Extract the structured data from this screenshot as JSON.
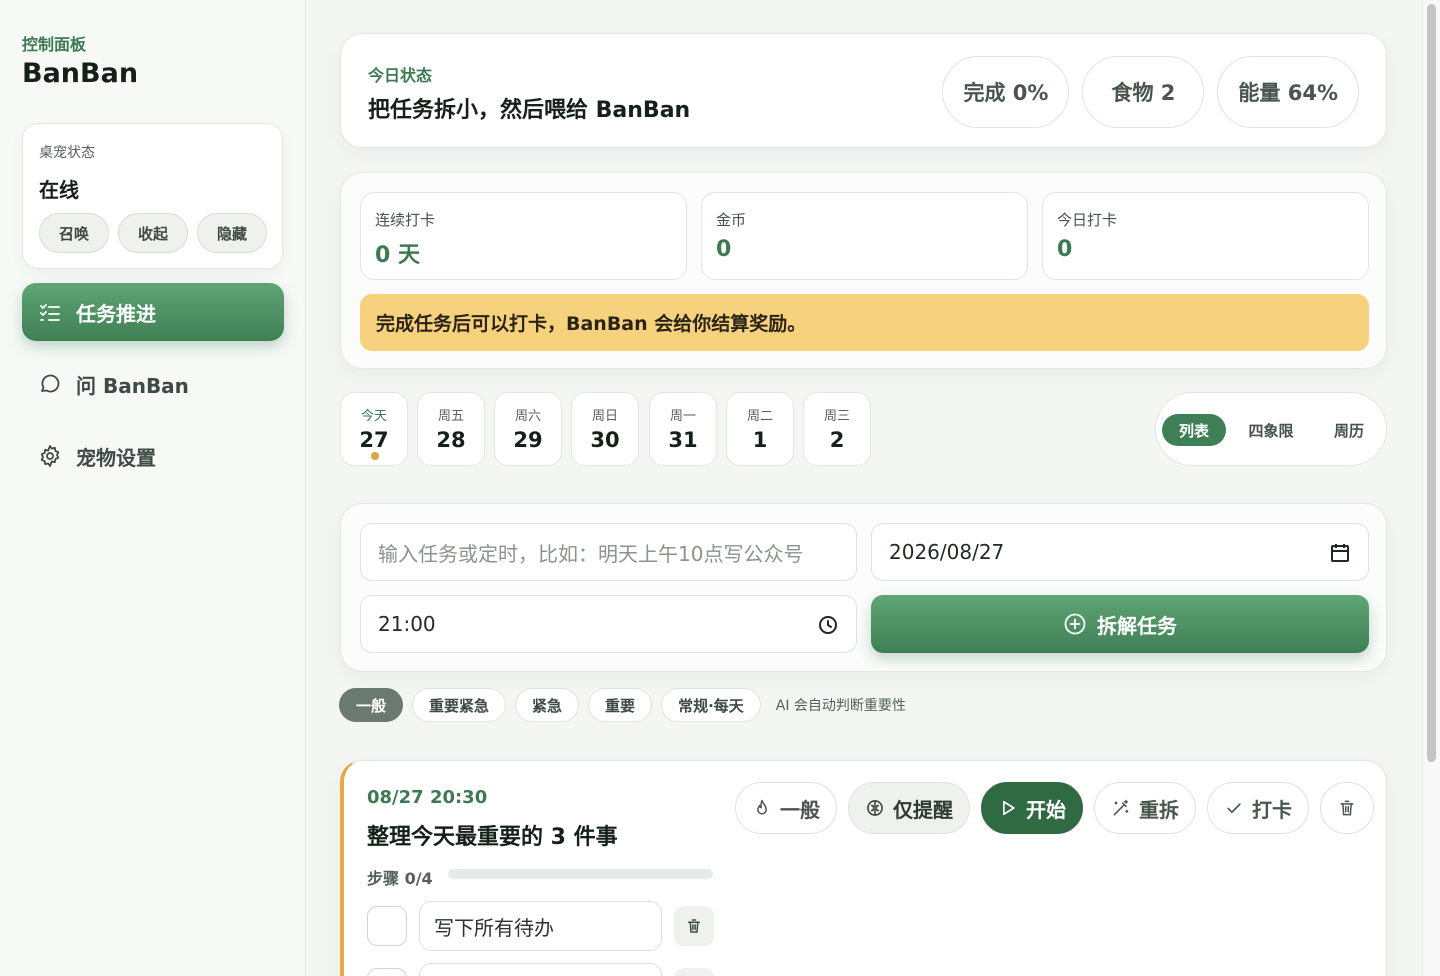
{
  "sidebar": {
    "subtitle": "控制面板",
    "brand": "BanBan",
    "pet_card": {
      "label": "桌宠状态",
      "status": "在线",
      "buttons": [
        "召唤",
        "收起",
        "隐藏"
      ]
    },
    "nav": [
      {
        "label": "任务推进",
        "icon": "checklist-icon",
        "active": true
      },
      {
        "label": "问 BanBan",
        "icon": "chat-bubble-icon",
        "active": false
      },
      {
        "label": "宠物设置",
        "icon": "gear-icon",
        "active": false
      }
    ]
  },
  "status": {
    "subtitle": "今日状态",
    "title": "把任务拆小，然后喂给 BanBan",
    "pills": [
      "完成 0%",
      "食物 2",
      "能量 64%"
    ]
  },
  "metrics": [
    {
      "label": "连续打卡",
      "value": "0 天"
    },
    {
      "label": "金币",
      "value": "0"
    },
    {
      "label": "今日打卡",
      "value": "0"
    }
  ],
  "notice": "完成任务后可以打卡，BanBan 会给你结算奖励。",
  "days": [
    {
      "weekday": "今天",
      "date": "27",
      "today": true
    },
    {
      "weekday": "周五",
      "date": "28"
    },
    {
      "weekday": "周六",
      "date": "29"
    },
    {
      "weekday": "周日",
      "date": "30"
    },
    {
      "weekday": "周一",
      "date": "31"
    },
    {
      "weekday": "周二",
      "date": "1"
    },
    {
      "weekday": "周三",
      "date": "2"
    }
  ],
  "view_toggle": [
    "列表",
    "四象限",
    "周历"
  ],
  "input": {
    "task_placeholder": "输入任务或定时，比如：明天上午10点写公众号",
    "date_value": "2026/08/27",
    "time_value": "21:00",
    "submit_label": "拆解任务"
  },
  "priorities": [
    "一般",
    "重要紧急",
    "紧急",
    "重要",
    "常规·每天"
  ],
  "priority_hint": "AI 会自动判断重要性",
  "task": {
    "time": "08/27 20:30",
    "title": "整理今天最重要的 3 件事",
    "steps_label": "步骤 0/4",
    "progress": 0,
    "actions": {
      "priority": "一般",
      "remind": "仅提醒",
      "start": "开始",
      "rebreak": "重拆",
      "checkin": "打卡"
    },
    "steps": [
      "写下所有待办"
    ]
  },
  "colors": {
    "accent": "#3f7f55",
    "accent_light": "#5fa574",
    "notice_bg": "#f6d27f",
    "task_border": "#e8a646",
    "today_dot": "#e0a343"
  }
}
